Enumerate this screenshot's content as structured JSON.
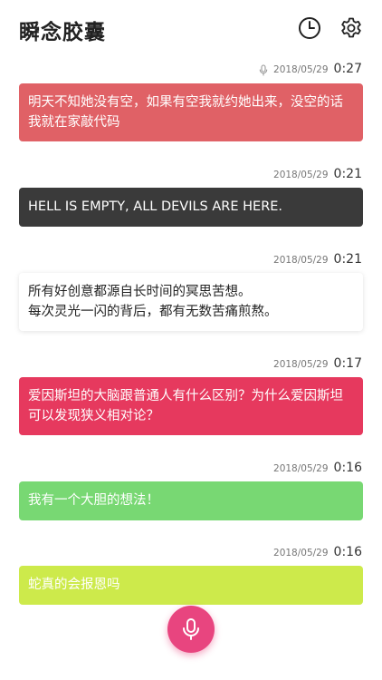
{
  "app": {
    "title": "瞬念胶囊"
  },
  "colors": {
    "red": "#e06166",
    "dark": "#3a3a3a",
    "white": "#ffffff",
    "pink": "#e6395e",
    "green": "#78d873",
    "lime": "#cdea4b",
    "fab": "#e8457f"
  },
  "header_icons": [
    "clock-icon",
    "gear-icon"
  ],
  "notes": [
    {
      "date": "2018/05/29",
      "duration": "0:27",
      "has_mic": true,
      "color": "red",
      "lines": [
        "明天不知她没有空，如果有空我就约她出来，没空的话我就在家敲代码"
      ]
    },
    {
      "date": "2018/05/29",
      "duration": "0:21",
      "has_mic": false,
      "color": "dark",
      "lines": [
        "HELL IS EMPTY, ALL DEVILS ARE HERE."
      ]
    },
    {
      "date": "2018/05/29",
      "duration": "0:21",
      "has_mic": false,
      "color": "white",
      "lines": [
        "所有好创意都源自长时间的冥思苦想。",
        "每次灵光一闪的背后，都有无数苦痛煎熬。"
      ]
    },
    {
      "date": "2018/05/29",
      "duration": "0:17",
      "has_mic": false,
      "color": "pink",
      "lines": [
        "爱因斯坦的大脑跟普通人有什么区别？为什么爱因斯坦可以发现狭义相对论？"
      ]
    },
    {
      "date": "2018/05/29",
      "duration": "0:16",
      "has_mic": false,
      "color": "green",
      "lines": [
        "我有一个大胆的想法！"
      ]
    },
    {
      "date": "2018/05/29",
      "duration": "0:16",
      "has_mic": false,
      "color": "lime",
      "lines": [
        "蛇真的会报恩吗"
      ]
    }
  ],
  "fab_icon": "microphone-icon"
}
